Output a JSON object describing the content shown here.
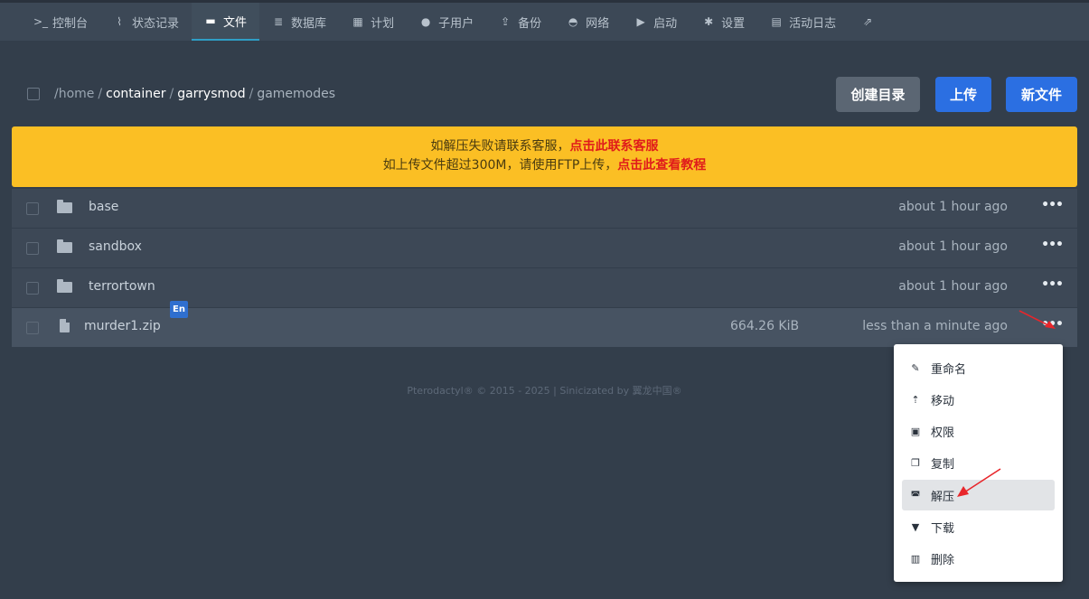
{
  "nav": [
    {
      "label": "控制台",
      "icon": "terminal-icon",
      "glyph": ">_"
    },
    {
      "label": "状态记录",
      "icon": "chart-line-icon",
      "glyph": "⌇"
    },
    {
      "label": "文件",
      "icon": "folder-open-icon",
      "glyph": "▬"
    },
    {
      "label": "数据库",
      "icon": "database-icon",
      "glyph": "≣"
    },
    {
      "label": "计划",
      "icon": "calendar-icon",
      "glyph": "▦"
    },
    {
      "label": "子用户",
      "icon": "users-icon",
      "glyph": "●"
    },
    {
      "label": "备份",
      "icon": "upload-icon",
      "glyph": "⇪"
    },
    {
      "label": "网络",
      "icon": "network-icon",
      "glyph": "◓"
    },
    {
      "label": "启动",
      "icon": "play-circle-icon",
      "glyph": "▶"
    },
    {
      "label": "设置",
      "icon": "cogs-icon",
      "glyph": "✱"
    },
    {
      "label": "活动日志",
      "icon": "log-icon",
      "glyph": "▤"
    },
    {
      "label": "",
      "icon": "external-link-icon",
      "glyph": "⇗"
    }
  ],
  "breadcrumb": {
    "root": "/home",
    "seg1": "container",
    "seg2": "garrysmod",
    "current": "gamemodes"
  },
  "actions": {
    "mkdir": "创建目录",
    "upload": "上传",
    "newfile": "新文件"
  },
  "notice": {
    "line1_prefix": "如解压失败请联系客服，",
    "line1_link": "点击此联系客服",
    "line2_prefix": "如上传文件超过300M，请使用FTP上传，",
    "line2_link": "点击此查看教程"
  },
  "files": [
    {
      "name": "base",
      "size": "",
      "modified": "about 1 hour ago",
      "type": "folder"
    },
    {
      "name": "sandbox",
      "size": "",
      "modified": "about 1 hour ago",
      "type": "folder"
    },
    {
      "name": "terrortown",
      "size": "",
      "modified": "about 1 hour ago",
      "type": "folder"
    },
    {
      "name": "murder1.zip",
      "size": "664.26 KiB",
      "modified": "less than a minute ago",
      "type": "archive"
    }
  ],
  "more_glyph": "•••",
  "ime_badge": "En",
  "footer": "Pterodactyl® © 2015 - 2025 | Sinicizated by 翼龙中国®",
  "context_menu": [
    {
      "label": "重命名",
      "icon": "pencil-icon",
      "glyph": "✎"
    },
    {
      "label": "移动",
      "icon": "level-up-icon",
      "glyph": "⇡"
    },
    {
      "label": "权限",
      "icon": "file-lock-icon",
      "glyph": "▣"
    },
    {
      "label": "复制",
      "icon": "copy-icon",
      "glyph": "❐"
    },
    {
      "label": "解压",
      "icon": "box-open-icon",
      "glyph": "◚"
    },
    {
      "label": "下载",
      "icon": "file-download-icon",
      "glyph": "▼"
    },
    {
      "label": "删除",
      "icon": "trash-icon",
      "glyph": "▥"
    }
  ],
  "colors": {
    "accent": "#2b6fe2",
    "notice_bg": "#fbbf24",
    "notice_link": "#e01b1b",
    "annotation_arrow": "#e8262b"
  }
}
